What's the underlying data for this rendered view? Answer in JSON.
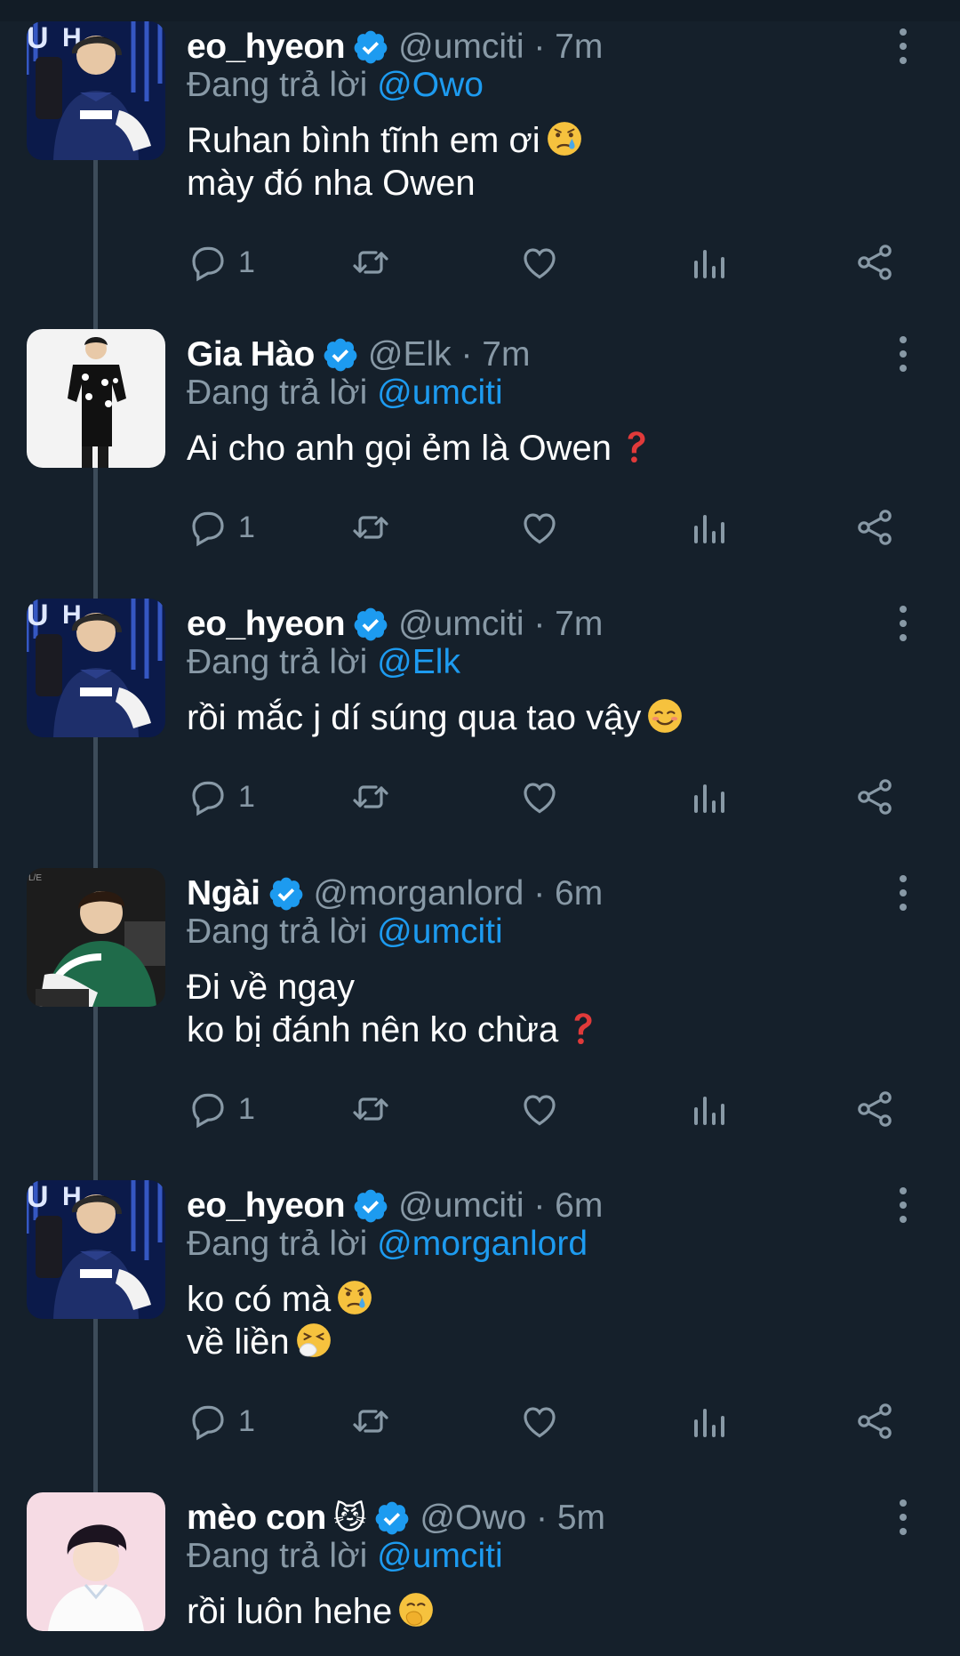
{
  "replying_prefix": "Đang trả lời",
  "colors": {
    "background": "#15202b",
    "mention": "#1d9bf0",
    "muted": "#8899a6",
    "verified": "#1d9bf0"
  },
  "tweets": [
    {
      "name": "eo_hyeon",
      "handle_time": "@umciti · 7m",
      "replying_to": "@Owo",
      "lines": [
        "Ruhan bình tĩnh em ơi",
        "mày đó nha Owen"
      ],
      "line_emoji": [
        "crying-face-icon",
        ""
      ],
      "reply_count": "1",
      "avatar": "esports-player-blue-jersey"
    },
    {
      "name": "Gia Hào",
      "handle_time": "@Elk · 7m",
      "replying_to": "@umciti",
      "lines": [
        "Ai cho anh gọi ẻm là Owen"
      ],
      "line_emoji": [
        "question-mark-icon"
      ],
      "reply_count": "1",
      "avatar": "person-black-outfit"
    },
    {
      "name": "eo_hyeon",
      "handle_time": "@umciti · 7m",
      "replying_to": "@Elk",
      "lines": [
        "rồi mắc j dí súng qua tao vậy"
      ],
      "line_emoji": [
        "smiling-face-icon"
      ],
      "reply_count": "1",
      "avatar": "esports-player-blue-jersey"
    },
    {
      "name": "Ngài",
      "handle_time": "@morganlord · 6m",
      "replying_to": "@umciti",
      "lines": [
        "Đi về ngay",
        "ko bị đánh nên ko chừa"
      ],
      "line_emoji": [
        "",
        "question-mark-icon"
      ],
      "reply_count": "1",
      "avatar": "player-green-jersey"
    },
    {
      "name": "eo_hyeon",
      "handle_time": "@umciti · 6m",
      "replying_to": "@morganlord",
      "lines": [
        "ko có mà",
        "về liền"
      ],
      "line_emoji": [
        "crying-face-icon",
        "sneezing-face-icon"
      ],
      "reply_count": "1",
      "avatar": "esports-player-blue-jersey"
    },
    {
      "name": "mèo con",
      "name_emoji": "😼",
      "handle_time": "@Owo · 5m",
      "replying_to": "@umciti",
      "lines": [
        "rồi luôn hehe"
      ],
      "line_emoji": [
        "hand-over-mouth-icon"
      ],
      "reply_count": "",
      "avatar": "person-white-shirt-pink-bg"
    }
  ]
}
